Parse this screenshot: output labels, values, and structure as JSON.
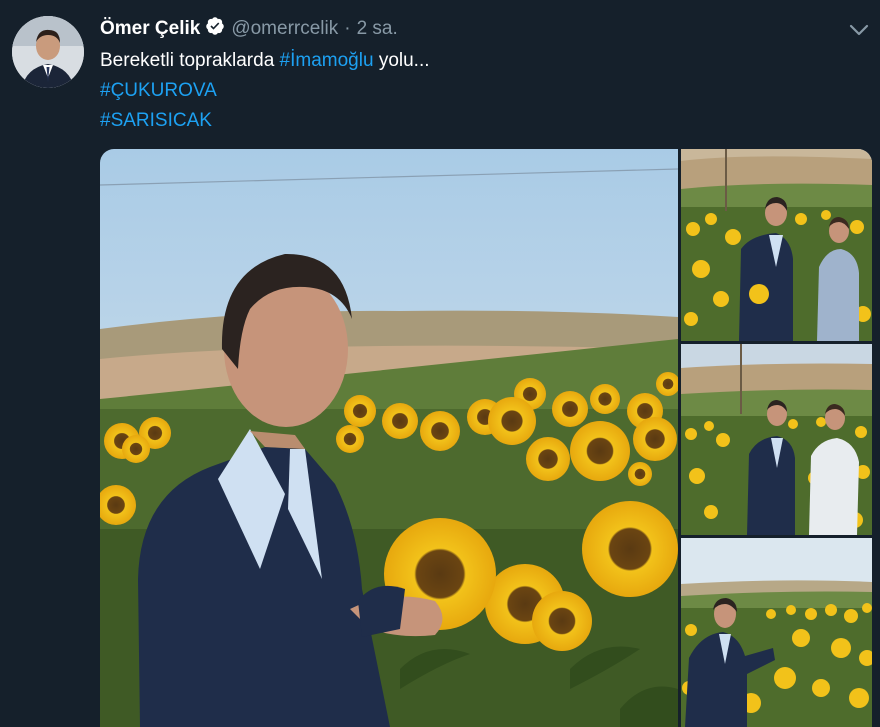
{
  "tweet": {
    "author_name": "Ömer Çelik",
    "author_handle": "@omerrcelik",
    "separator": "·",
    "time": "2 sa.",
    "text_line1_before": "Bereketli topraklarda ",
    "text_line1_hashtag": "#İmamoğlu",
    "text_line1_after": " yolu...",
    "hashtag2": "#ÇUKUROVA",
    "hashtag3": "#SARISICAK"
  },
  "media": {
    "photos": [
      {
        "name": "main-photo",
        "scene": "man-in-sunflower-field"
      },
      {
        "name": "photo-top-right",
        "scene": "two-men-in-sunflower-field"
      },
      {
        "name": "photo-middle-right",
        "scene": "two-men-in-sunflower-field"
      },
      {
        "name": "photo-bottom-right",
        "scene": "man-in-sunflower-field"
      }
    ]
  },
  "icons": {
    "verified": "verified-badge-icon",
    "menu": "chevron-down-icon"
  },
  "colors": {
    "background": "#15202b",
    "link": "#1da1f2",
    "muted": "#8899a6",
    "sunflower": "#f2c21a",
    "jacket": "#1f2d4a"
  }
}
